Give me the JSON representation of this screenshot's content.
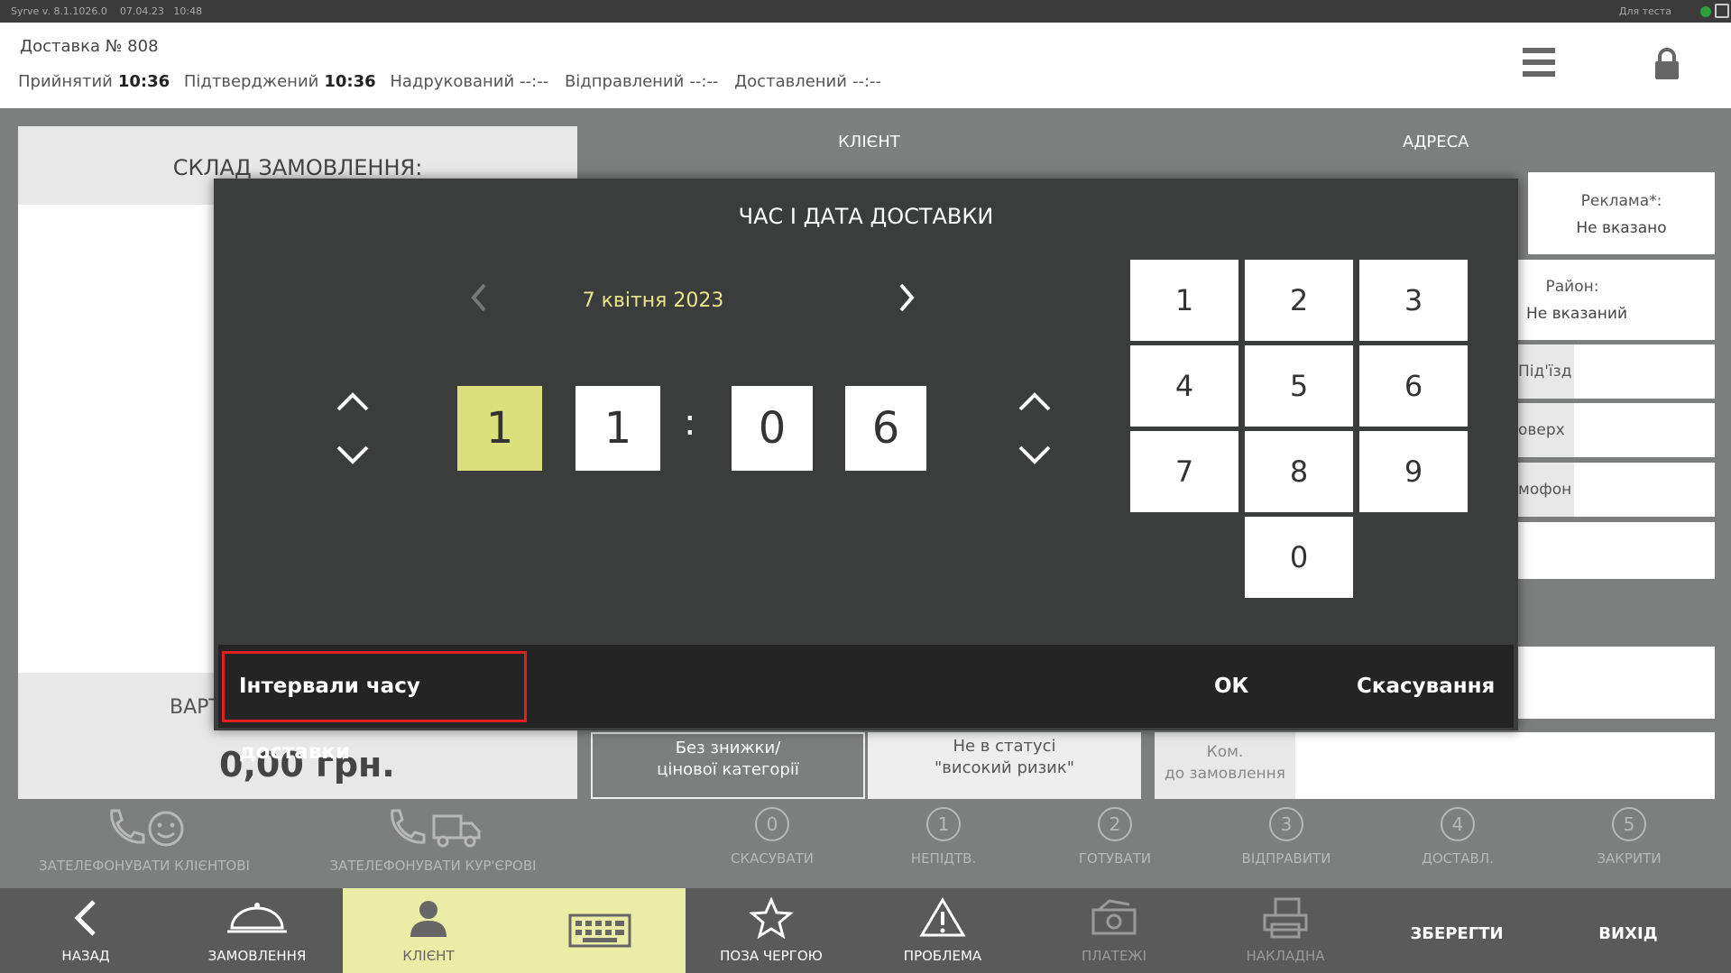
{
  "system": {
    "version": "Syrve v. 8.1.1026.0",
    "date": "07.04.23",
    "time": "10:48",
    "env": "Для теста"
  },
  "header": {
    "title": "Доставка № 808",
    "statuses": [
      {
        "label": "Прийнятий",
        "value": "10:36"
      },
      {
        "label": "Підтверджений",
        "value": "10:36"
      },
      {
        "label": "Надрукований",
        "value": "--:--"
      },
      {
        "label": "Відправлений",
        "value": "--:--"
      },
      {
        "label": "Доставлений",
        "value": "--:--"
      }
    ]
  },
  "left_panel": {
    "title": "СКЛАД ЗАМОВЛЕННЯ:",
    "cost_label": "ВАРТ",
    "cost": "0,00 грн."
  },
  "columns": {
    "client": "КЛІЄНТ",
    "address": "АДРЕСА"
  },
  "address_fields": {
    "ad_label": "Реклама*:",
    "ad_value": "Не вказано",
    "district_label": "Район:",
    "district_value": "Не вказаний",
    "entrance": "Під'їзд",
    "floor": "оверх",
    "intercom": "мофон"
  },
  "mid_boxes": {
    "discount": "Без знижки/\nцінової категорії",
    "risk": "Не в статусі\n\"високий ризик\"",
    "comment": "Ком.\nдо замовлення"
  },
  "actions": [
    {
      "label": "ЗАТЕЛЕФОНУВАТИ КЛІЄНТОВІ"
    },
    {
      "label": "ЗАТЕЛЕФОНУВАТИ КУР'ЄРОВІ"
    },
    {
      "num": "0",
      "label": "СКАСУВАТИ"
    },
    {
      "num": "1",
      "label": "НЕПІДТВ."
    },
    {
      "num": "2",
      "label": "ГОТУВАТИ"
    },
    {
      "num": "3",
      "label": "ВІДПРАВИТИ"
    },
    {
      "num": "4",
      "label": "ДОСТАВЛ."
    },
    {
      "num": "5",
      "label": "ЗАКРИТИ"
    }
  ],
  "toolbar": {
    "back": "НАЗАД",
    "orders": "ЗАМОВЛЕННЯ",
    "client": "КЛІЄНТ",
    "priority": "ПОЗА ЧЕРГОЮ",
    "problem": "ПРОБЛЕМА",
    "payments": "ПЛАТЕЖІ",
    "invoice": "НАКЛАДНА",
    "save": "ЗБЕРЕГТИ",
    "exit": "ВИХІД"
  },
  "modal": {
    "title": "ЧАС І ДАТА ДОСТАВКИ",
    "date": "7 квітня 2023",
    "hour_digits": [
      "1",
      "1"
    ],
    "minute_digits": [
      "0",
      "6"
    ],
    "colon": ":",
    "keys": [
      "1",
      "2",
      "3",
      "4",
      "5",
      "6",
      "7",
      "8",
      "9",
      "0"
    ],
    "interval_button": "Інтервали часу доставки",
    "ok": "ОК",
    "cancel": "Скасування"
  },
  "colors": {
    "accent_yellow": "#dbdf7c",
    "date_text": "#e8e58a",
    "highlight_red": "#e31e1e",
    "modal_bg": "#3b3c3c"
  }
}
